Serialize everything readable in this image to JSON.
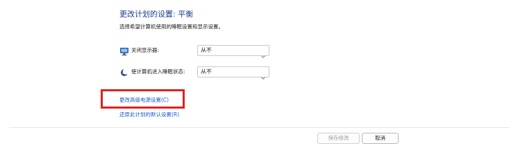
{
  "header": {
    "title": "更改计划的设置: 平衡",
    "subtitle": "选择希望计算机使用的睡眠设置和显示设置。"
  },
  "settings": [
    {
      "label": "关闭显示器:",
      "value": "从不",
      "icon": "monitor-icon"
    },
    {
      "label": "使计算机进入睡眠状态:",
      "value": "从不",
      "icon": "moon-icon"
    }
  ],
  "links": {
    "advanced": "更改高级电源设置(C)",
    "restore": "还原此计划的默认设置(R)"
  },
  "buttons": {
    "save": "保存修改",
    "cancel": "取消"
  },
  "colors": {
    "title": "#1e3c8c",
    "link": "#1a5cc8",
    "highlight": "#e02020"
  }
}
